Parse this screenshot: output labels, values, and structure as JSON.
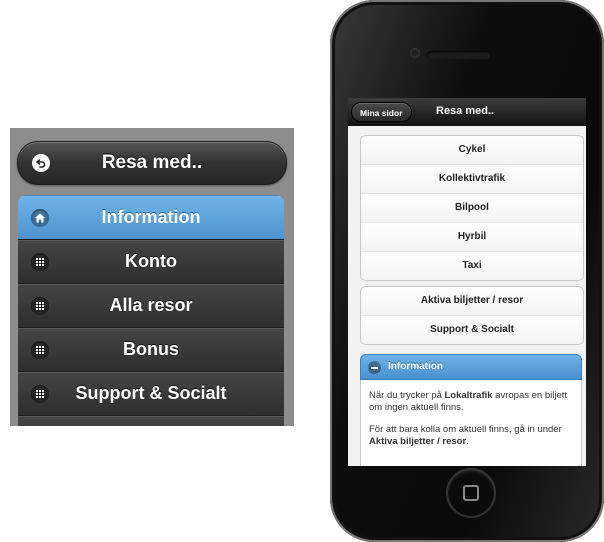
{
  "left_panel": {
    "top_button": {
      "label": "Resa med..",
      "icon": "back-arrow-icon"
    },
    "menu_items": [
      {
        "label": "Information",
        "icon": "home-icon",
        "active": true
      },
      {
        "label": "Konto",
        "icon": "grid-icon",
        "active": false
      },
      {
        "label": "Alla resor",
        "icon": "grid-icon",
        "active": false
      },
      {
        "label": "Bonus",
        "icon": "grid-icon",
        "active": false
      },
      {
        "label": "Support & Socialt",
        "icon": "grid-icon",
        "active": false
      }
    ],
    "colors": {
      "panel_bg": "#8d8d8d",
      "item_bg": "#3a3a3a",
      "active_bg": "#5ea3df"
    }
  },
  "phone": {
    "header": {
      "back_label": "Mina sidor",
      "title": "Resa med.."
    },
    "travel_options": [
      "Cykel",
      "Kollektivtrafik",
      "Bilpool",
      "Hyrbil",
      "Taxi"
    ],
    "secondary_options": [
      "Aktiva biljetter / resor",
      "Support & Socialt"
    ],
    "collapsible": {
      "title": "Information",
      "p1_before": "När du trycker på ",
      "p1_bold": "Lokaltrafik",
      "p1_after": " avropas en biljett om ingen aktuell finns.",
      "p2_before": "För att bara kolla om aktuell finns, gå in under ",
      "p2_bold": "Aktiva biljetter / resor",
      "p2_after": "."
    }
  }
}
